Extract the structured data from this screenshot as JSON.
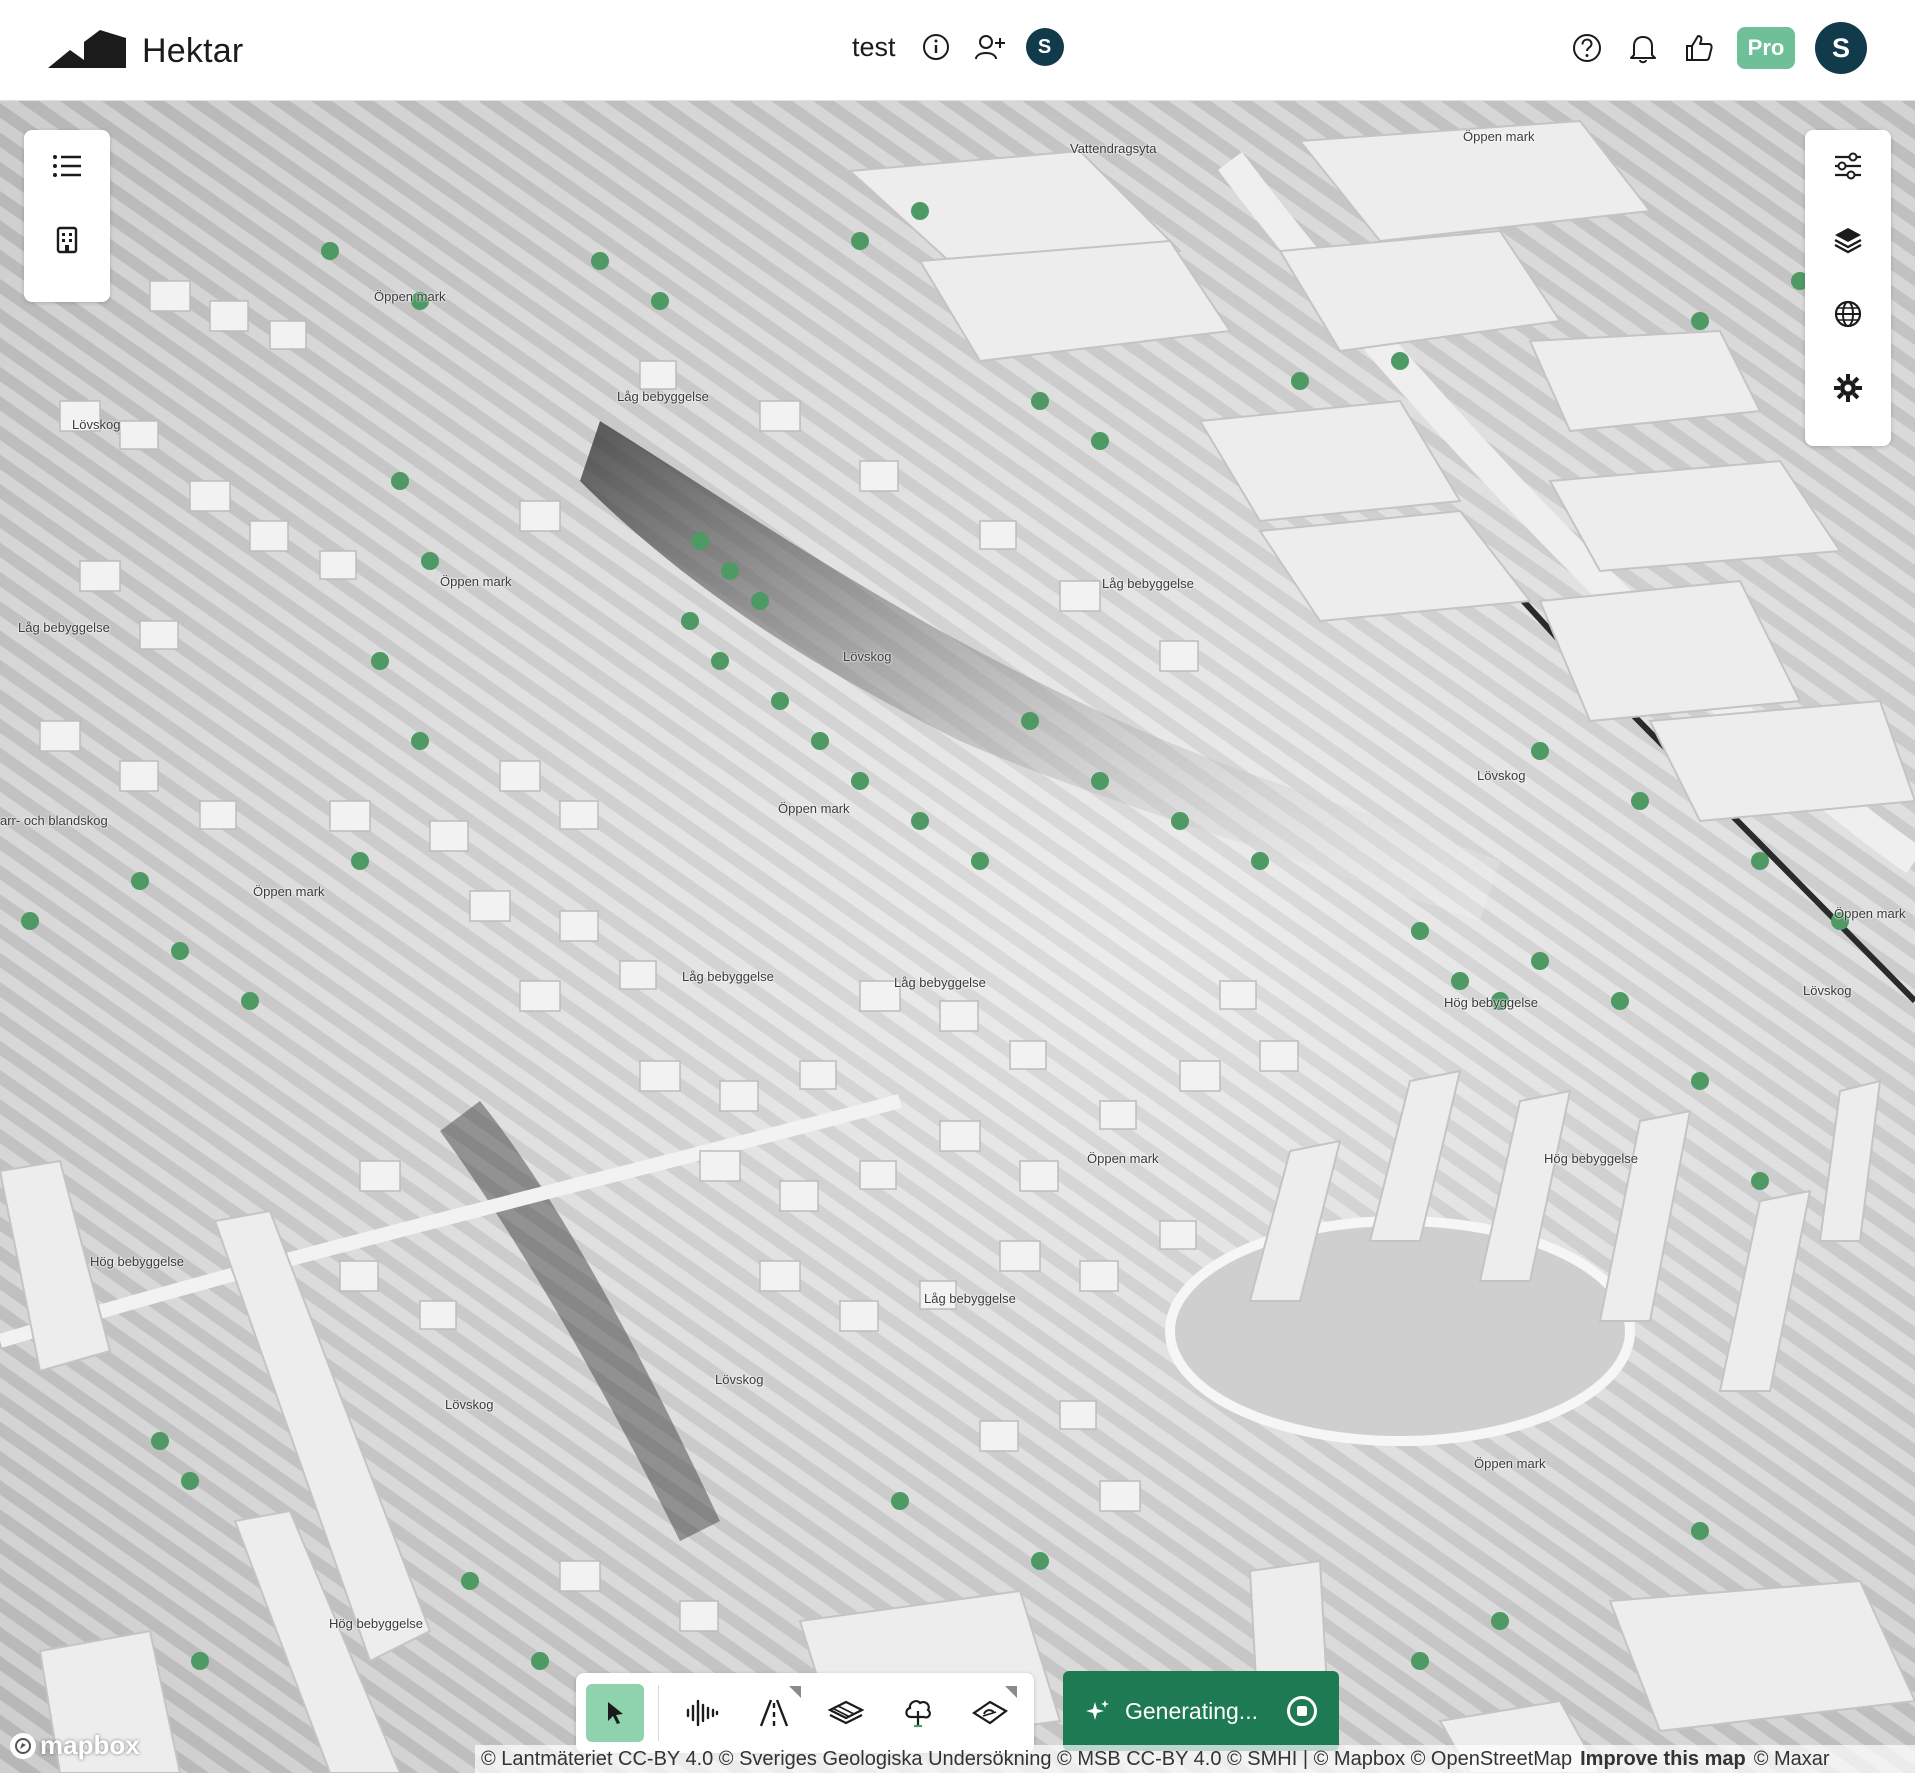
{
  "header": {
    "brand": "Hektar",
    "project_name": "test",
    "user_initial": "S",
    "pro_label": "Pro",
    "account_initial": "S"
  },
  "left_panel": {
    "items": [
      "list-icon",
      "building-icon"
    ]
  },
  "right_panel": {
    "items": [
      "sliders-icon",
      "layers-icon",
      "globe-icon",
      "gear-icon"
    ]
  },
  "map": {
    "labels": [
      {
        "text": "Vattendragsyta"
      },
      {
        "text": "Öppen mark"
      },
      {
        "text": "Öppen mark"
      },
      {
        "text": "Lövskog"
      },
      {
        "text": "Låg bebyggelse"
      },
      {
        "text": "Öppen mark"
      },
      {
        "text": "Låg bebyggelse"
      },
      {
        "text": "Låg bebyggelse"
      },
      {
        "text": "Lövskog"
      },
      {
        "text": "Lövskog"
      },
      {
        "text": "Öppen mark"
      },
      {
        "text": "arr- och blandskog"
      },
      {
        "text": "Öppen mark"
      },
      {
        "text": "Öppen mark"
      },
      {
        "text": "Låg bebyggelse"
      },
      {
        "text": "Låg bebyggelse"
      },
      {
        "text": "Hög bebyggelse"
      },
      {
        "text": "Lövskog"
      },
      {
        "text": "Öppen mark"
      },
      {
        "text": "Hög bebyggelse"
      },
      {
        "text": "Hög bebyggelse"
      },
      {
        "text": "Låg bebyggelse"
      },
      {
        "text": "Lövskog"
      },
      {
        "text": "Lövskog"
      },
      {
        "text": "Öppen mark"
      },
      {
        "text": "Hög bebyggelse"
      }
    ]
  },
  "toolbar": {
    "tools": [
      {
        "name": "select-tool",
        "icon": "cursor-icon"
      },
      {
        "name": "noise-tool",
        "icon": "sound-wave-icon"
      },
      {
        "name": "road-tool",
        "icon": "road-icon"
      },
      {
        "name": "surface-tool",
        "icon": "layer-stack-icon"
      },
      {
        "name": "tree-tool",
        "icon": "tree-icon"
      },
      {
        "name": "area-tool",
        "icon": "area-icon"
      }
    ],
    "generate_label": "Generating..."
  },
  "attribution": {
    "text": "© Lantmäteriet CC-BY 4.0 © Sveriges Geologiska Undersökning © MSB CC-BY 4.0 © SMHI | © Mapbox © OpenStreetMap",
    "improve": "Improve this map",
    "maxar": "© Maxar"
  },
  "mapbox_logo": "mapbox",
  "colors": {
    "accent_green": "#1e7a52",
    "pro_green": "#6fbf98",
    "active_tool": "#8fd3ae",
    "avatar_navy": "#113a4a",
    "tree_green": "#4f9a64",
    "building_white": "#eeeeee"
  }
}
